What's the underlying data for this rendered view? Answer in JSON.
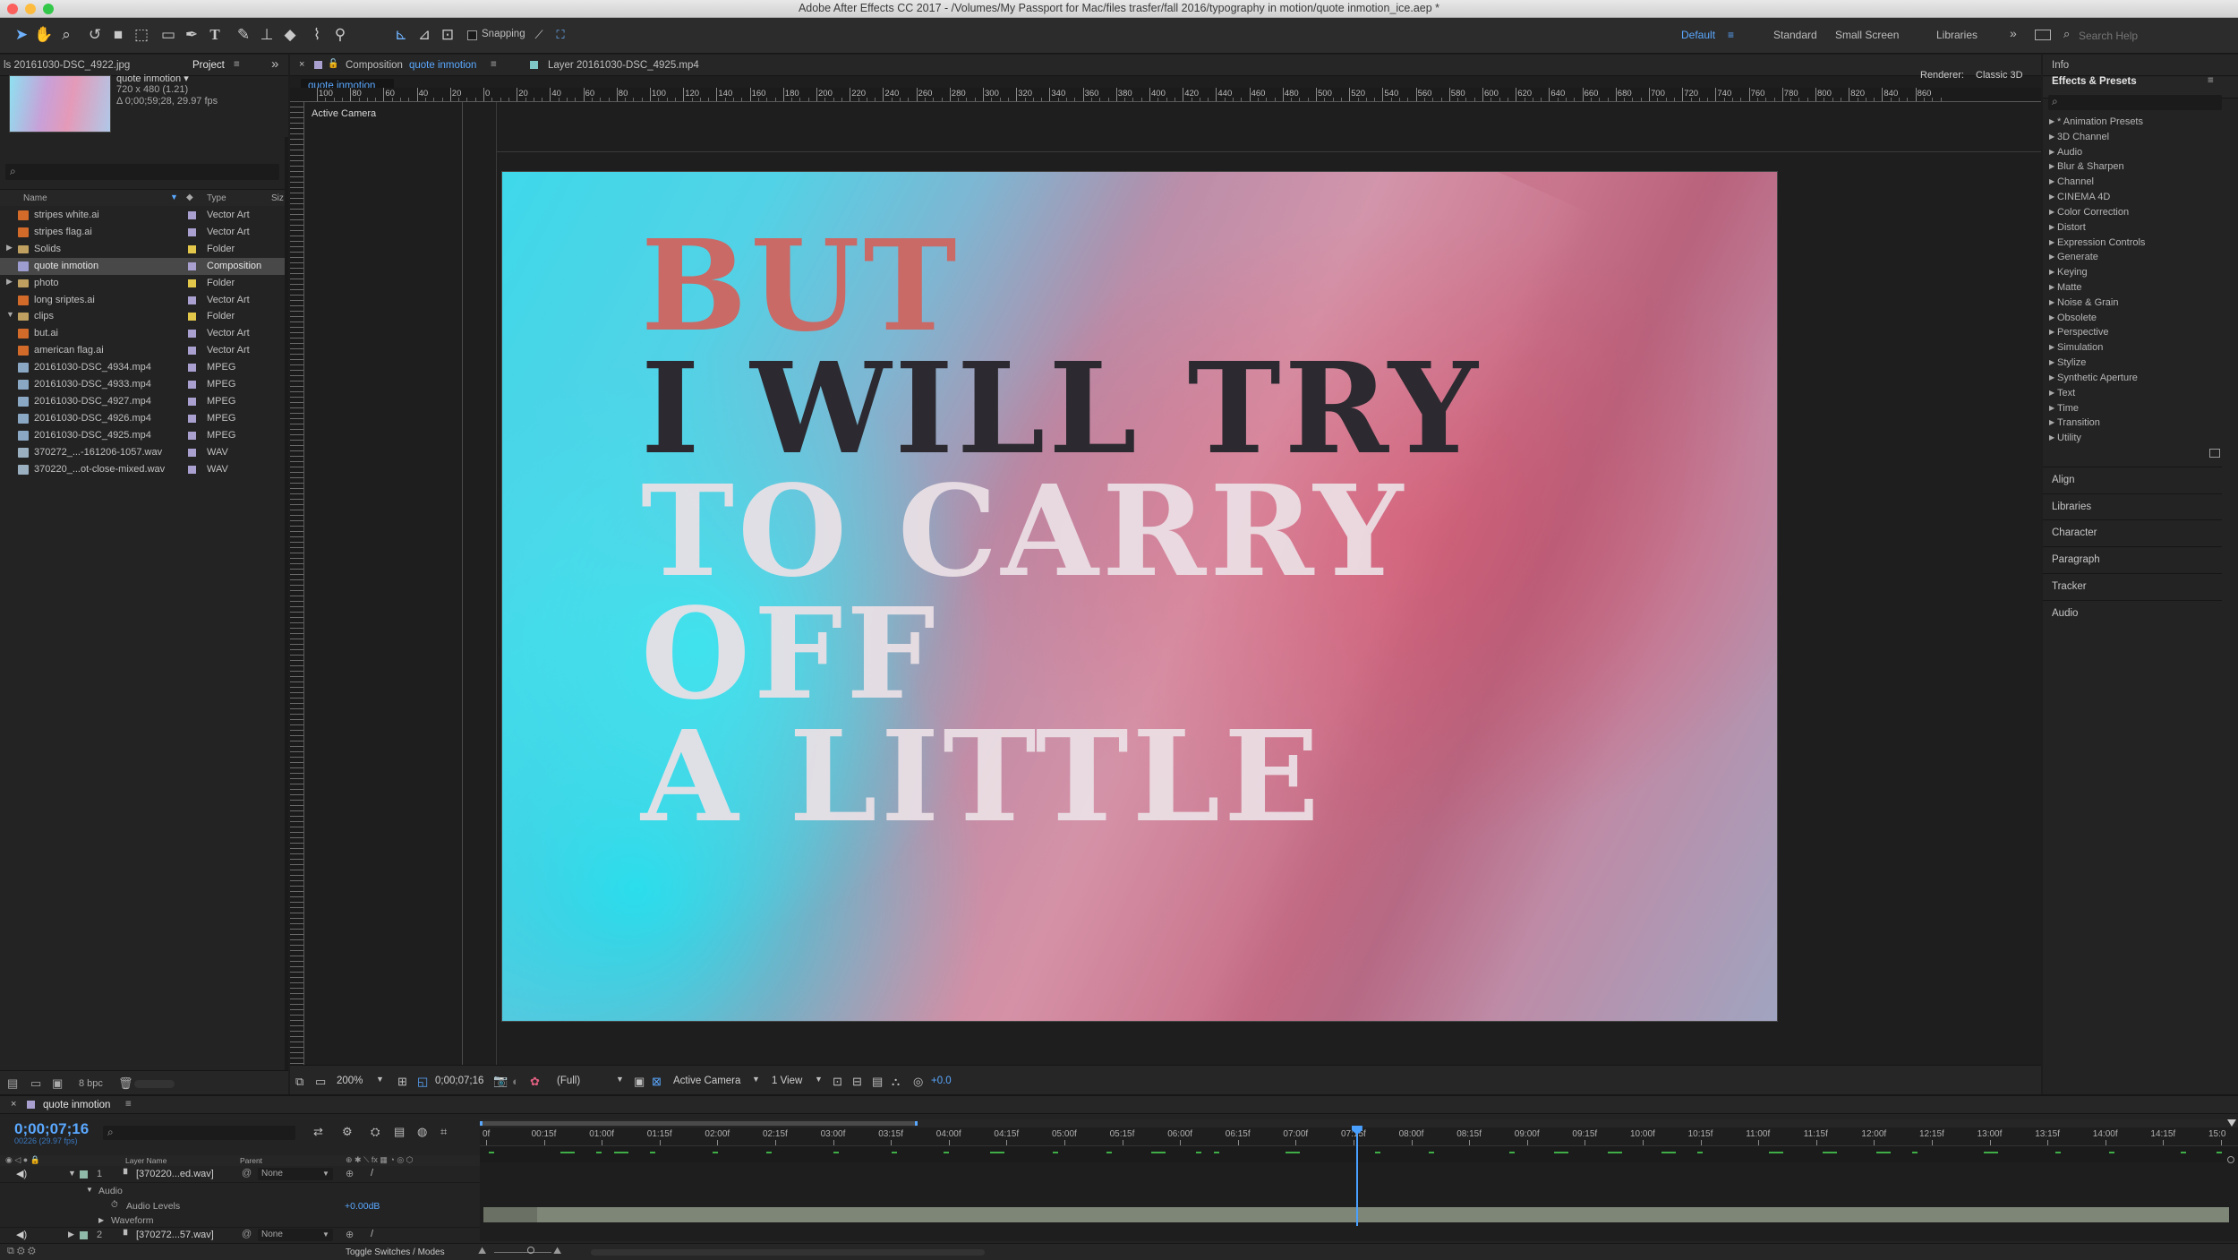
{
  "window": {
    "title": "Adobe After Effects CC 2017 - /Volumes/My Passport for Mac/files trasfer/fall 2016/typography in motion/quote inmotion_ice.aep *"
  },
  "toolbar": {
    "snapping_label": "Snapping",
    "workspaces": [
      "Default",
      "Standard",
      "Small Screen",
      "Libraries"
    ],
    "search_placeholder": "Search Help"
  },
  "project_panel": {
    "footage_tab": "ls 20161030-DSC_4922.jpg",
    "project_tab": "Project",
    "selected_name": "quote inmotion ▾",
    "selected_dims": "720 x 480 (1.21)",
    "selected_duration": "Δ 0;00;59;28, 29.97 fps",
    "col_name": "Name",
    "col_type": "Type",
    "col_size": "Siz",
    "items": [
      {
        "name": "stripes white.ai",
        "type": "Vector Art",
        "label_color": "#a9a0d0",
        "icon": "ai-file-icon"
      },
      {
        "name": "stripes flag.ai",
        "type": "Vector Art",
        "label_color": "#a9a0d0",
        "icon": "ai-file-icon"
      },
      {
        "name": "Solids",
        "type": "Folder",
        "label_color": "#e2c74a",
        "icon": "folder-icon"
      },
      {
        "name": "quote inmotion",
        "type": "Composition",
        "label_color": "#a9a0d0",
        "icon": "composition-icon",
        "selected": true
      },
      {
        "name": "photo",
        "type": "Folder",
        "label_color": "#e2c74a",
        "icon": "folder-icon"
      },
      {
        "name": "long sriptes.ai",
        "type": "Vector Art",
        "label_color": "#a9a0d0",
        "icon": "ai-file-icon"
      },
      {
        "name": "clips",
        "type": "Folder",
        "label_color": "#e2c74a",
        "icon": "folder-icon"
      },
      {
        "name": "but.ai",
        "type": "Vector Art",
        "label_color": "#a9a0d0",
        "icon": "ai-file-icon"
      },
      {
        "name": "american flag.ai",
        "type": "Vector Art",
        "label_color": "#a9a0d0",
        "icon": "ai-file-icon"
      },
      {
        "name": "20161030-DSC_4934.mp4",
        "type": "MPEG",
        "label_color": "#a9a0d0",
        "icon": "video-file-icon"
      },
      {
        "name": "20161030-DSC_4933.mp4",
        "type": "MPEG",
        "label_color": "#a9a0d0",
        "icon": "video-file-icon"
      },
      {
        "name": "20161030-DSC_4927.mp4",
        "type": "MPEG",
        "label_color": "#a9a0d0",
        "icon": "video-file-icon"
      },
      {
        "name": "20161030-DSC_4926.mp4",
        "type": "MPEG",
        "label_color": "#a9a0d0",
        "icon": "video-file-icon"
      },
      {
        "name": "20161030-DSC_4925.mp4",
        "type": "MPEG",
        "label_color": "#a9a0d0",
        "icon": "video-file-icon"
      },
      {
        "name": "370272_...-161206-1057.wav",
        "type": "WAV",
        "label_color": "#a9a0d0",
        "icon": "audio-file-icon"
      },
      {
        "name": "370220_...ot-close-mixed.wav",
        "type": "WAV",
        "label_color": "#a9a0d0",
        "icon": "audio-file-icon"
      }
    ],
    "bpc": "8 bpc"
  },
  "comp_panel": {
    "tab_prefix": "Composition",
    "tab_name": "quote inmotion",
    "layer_tab": "Layer 20161030-DSC_4925.mp4",
    "flow_chip": "quote inmotion",
    "renderer_label": "Renderer:",
    "renderer_value": "Classic 3D",
    "view_label": "Active Camera",
    "ruler_ticks": [
      "100",
      "80",
      "60",
      "40",
      "20",
      "0",
      "20",
      "40",
      "60",
      "80",
      "100",
      "120",
      "140",
      "160",
      "180",
      "200",
      "220",
      "240",
      "260",
      "280",
      "300",
      "320",
      "340",
      "360",
      "380",
      "400",
      "420",
      "440",
      "460",
      "480",
      "500",
      "520",
      "540",
      "560",
      "580",
      "600",
      "620",
      "640",
      "660",
      "680",
      "700",
      "720",
      "740",
      "760",
      "780",
      "800",
      "820",
      "840",
      "860"
    ],
    "canvas_lines": [
      "BUT",
      "I WILL TRY",
      "TO CARRY",
      "OFF",
      "A LITTLE"
    ],
    "line_colors": [
      "#c96a66",
      "#2c2a30",
      "#ece1e6",
      "#ece1e6",
      "#ece1e6"
    ],
    "footer": {
      "zoom": "200%",
      "timecode": "0;00;07;16",
      "resolution": "(Full)",
      "camera": "Active Camera",
      "views": "1 View",
      "exposure": "+0.0"
    }
  },
  "effects_panel": {
    "info_tab": "Info",
    "title": "Effects & Presets",
    "categories": [
      "* Animation Presets",
      "3D Channel",
      "Audio",
      "Blur & Sharpen",
      "Channel",
      "CINEMA 4D",
      "Color Correction",
      "Distort",
      "Expression Controls",
      "Generate",
      "Keying",
      "Matte",
      "Noise & Grain",
      "Obsolete",
      "Perspective",
      "Simulation",
      "Stylize",
      "Synthetic Aperture",
      "Text",
      "Time",
      "Transition",
      "Utility"
    ],
    "other_panels": [
      "Align",
      "Libraries",
      "Character",
      "Paragraph",
      "Tracker",
      "Audio"
    ]
  },
  "timeline": {
    "tab": "quote inmotion",
    "timecode": "0;00;07;16",
    "frame_info": "00226 (29.97 fps)",
    "col_layer_name": "Layer Name",
    "col_parent": "Parent",
    "ticks": [
      "0f",
      "00:15f",
      "01:00f",
      "01:15f",
      "02:00f",
      "02:15f",
      "03:00f",
      "03:15f",
      "04:00f",
      "04:15f",
      "05:00f",
      "05:15f",
      "06:00f",
      "06:15f",
      "07:00f",
      "07:15f",
      "08:00f",
      "08:15f",
      "09:00f",
      "09:15f",
      "10:00f",
      "10:15f",
      "11:00f",
      "11:15f",
      "12:00f",
      "12:15f",
      "13:00f",
      "13:15f",
      "14:00f",
      "14:15f",
      "15:0"
    ],
    "playhead_time_s": 7.53,
    "layers": [
      {
        "num": "1",
        "name": "[370220...ed.wav]",
        "parent": "None"
      },
      {
        "num": "2",
        "name": "[370272...57.wav]",
        "parent": "None"
      }
    ],
    "audio_group": "Audio",
    "audio_levels_label": "Audio Levels",
    "audio_levels_value": "+0.00dB",
    "waveform_label": "Waveform",
    "footer_toggle": "Toggle Switches / Modes"
  },
  "colors": {
    "accent_blue": "#3c9cff",
    "panel_bg": "#232323",
    "label_lavender": "#a9a0d0",
    "label_yellow": "#e2c74a"
  }
}
